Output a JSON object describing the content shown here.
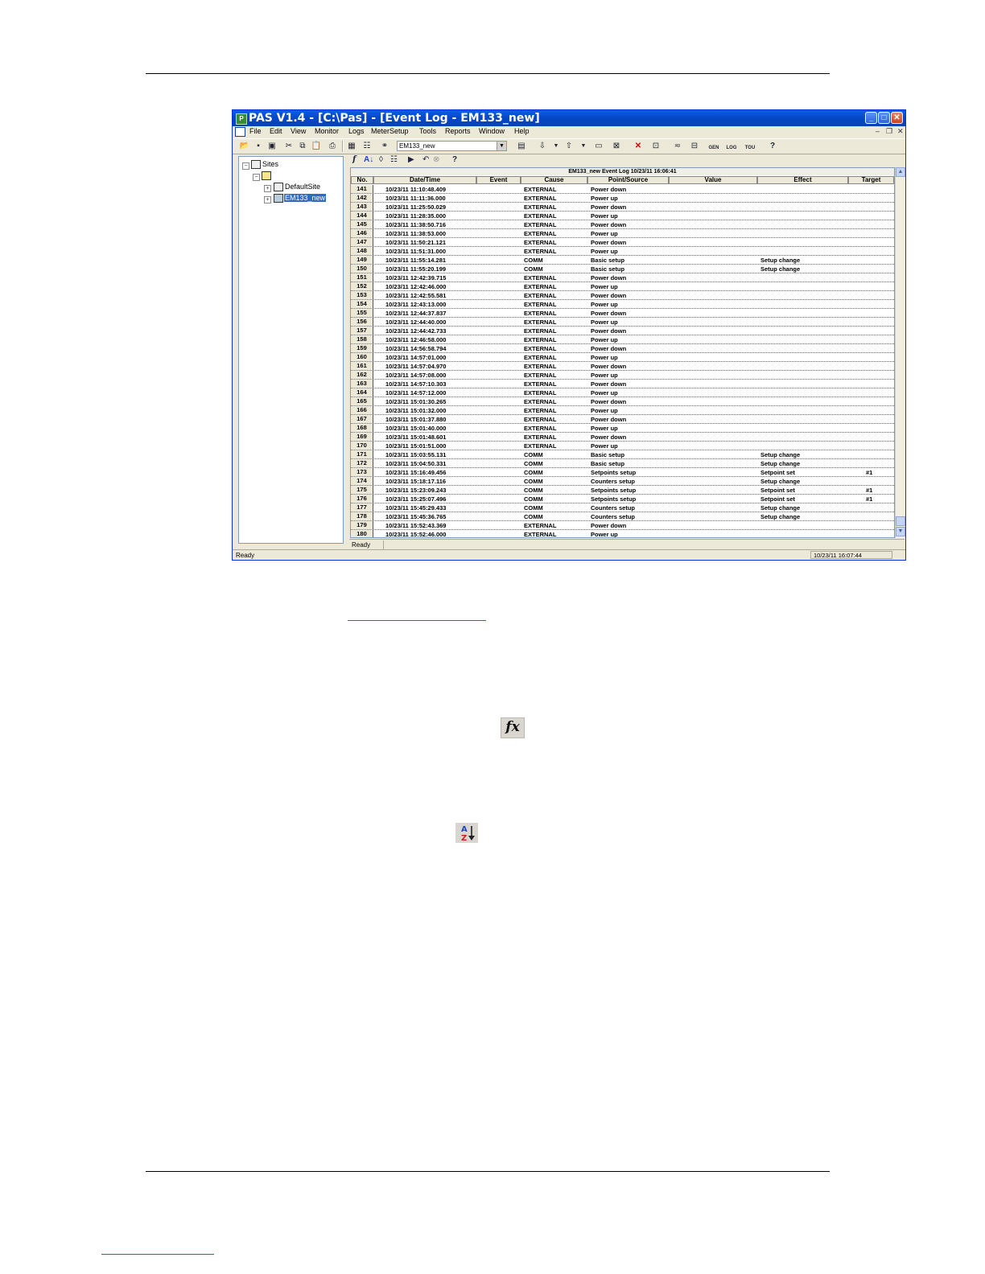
{
  "window": {
    "title": "PAS V1.4 - [C:\\Pas] - [Event Log - EM133_new]",
    "app_icon_label": "P"
  },
  "menu": [
    "File",
    "Edit",
    "View",
    "Monitor",
    "Logs",
    "MeterSetup",
    "Tools",
    "Reports",
    "Window",
    "Help"
  ],
  "toolbar": {
    "meter_selected": "EM133_new",
    "gen_label": "GEN",
    "log_label": "LOG",
    "tou_label": "TOU"
  },
  "tree": {
    "root": "Sites",
    "site": "DefaultSite",
    "meter": "EM133_new"
  },
  "grid": {
    "caption": "EM133_new  Event Log   10/23/11 16:06:41",
    "headers": [
      "No.",
      "Date/Time",
      "Event",
      "Cause",
      "Point/Source",
      "Value",
      "Effect",
      "Target"
    ],
    "rows": [
      [
        "141",
        "10/23/11  11:10:48.409",
        "",
        "EXTERNAL",
        "Power down",
        "",
        "",
        ""
      ],
      [
        "142",
        "10/23/11  11:11:36.000",
        "",
        "EXTERNAL",
        "Power up",
        "",
        "",
        ""
      ],
      [
        "143",
        "10/23/11  11:25:50.029",
        "",
        "EXTERNAL",
        "Power down",
        "",
        "",
        ""
      ],
      [
        "144",
        "10/23/11  11:28:35.000",
        "",
        "EXTERNAL",
        "Power up",
        "",
        "",
        ""
      ],
      [
        "145",
        "10/23/11  11:38:50.716",
        "",
        "EXTERNAL",
        "Power down",
        "",
        "",
        ""
      ],
      [
        "146",
        "10/23/11  11:38:53.000",
        "",
        "EXTERNAL",
        "Power up",
        "",
        "",
        ""
      ],
      [
        "147",
        "10/23/11  11:50:21.121",
        "",
        "EXTERNAL",
        "Power down",
        "",
        "",
        ""
      ],
      [
        "148",
        "10/23/11  11:51:31.000",
        "",
        "EXTERNAL",
        "Power up",
        "",
        "",
        ""
      ],
      [
        "149",
        "10/23/11  11:55:14.281",
        "",
        "COMM",
        "Basic setup",
        "",
        "Setup change",
        ""
      ],
      [
        "150",
        "10/23/11  11:55:20.199",
        "",
        "COMM",
        "Basic setup",
        "",
        "Setup change",
        ""
      ],
      [
        "151",
        "10/23/11  12:42:39.715",
        "",
        "EXTERNAL",
        "Power down",
        "",
        "",
        ""
      ],
      [
        "152",
        "10/23/11  12:42:46.000",
        "",
        "EXTERNAL",
        "Power up",
        "",
        "",
        ""
      ],
      [
        "153",
        "10/23/11  12:42:55.581",
        "",
        "EXTERNAL",
        "Power down",
        "",
        "",
        ""
      ],
      [
        "154",
        "10/23/11  12:43:13.000",
        "",
        "EXTERNAL",
        "Power up",
        "",
        "",
        ""
      ],
      [
        "155",
        "10/23/11  12:44:37.837",
        "",
        "EXTERNAL",
        "Power down",
        "",
        "",
        ""
      ],
      [
        "156",
        "10/23/11  12:44:40.000",
        "",
        "EXTERNAL",
        "Power up",
        "",
        "",
        ""
      ],
      [
        "157",
        "10/23/11  12:44:42.733",
        "",
        "EXTERNAL",
        "Power down",
        "",
        "",
        ""
      ],
      [
        "158",
        "10/23/11  12:46:58.000",
        "",
        "EXTERNAL",
        "Power up",
        "",
        "",
        ""
      ],
      [
        "159",
        "10/23/11  14:56:58.794",
        "",
        "EXTERNAL",
        "Power down",
        "",
        "",
        ""
      ],
      [
        "160",
        "10/23/11  14:57:01.000",
        "",
        "EXTERNAL",
        "Power up",
        "",
        "",
        ""
      ],
      [
        "161",
        "10/23/11  14:57:04.970",
        "",
        "EXTERNAL",
        "Power down",
        "",
        "",
        ""
      ],
      [
        "162",
        "10/23/11  14:57:08.000",
        "",
        "EXTERNAL",
        "Power up",
        "",
        "",
        ""
      ],
      [
        "163",
        "10/23/11  14:57:10.303",
        "",
        "EXTERNAL",
        "Power down",
        "",
        "",
        ""
      ],
      [
        "164",
        "10/23/11  14:57:12.000",
        "",
        "EXTERNAL",
        "Power up",
        "",
        "",
        ""
      ],
      [
        "165",
        "10/23/11  15:01:30.265",
        "",
        "EXTERNAL",
        "Power down",
        "",
        "",
        ""
      ],
      [
        "166",
        "10/23/11  15:01:32.000",
        "",
        "EXTERNAL",
        "Power up",
        "",
        "",
        ""
      ],
      [
        "167",
        "10/23/11  15:01:37.880",
        "",
        "EXTERNAL",
        "Power down",
        "",
        "",
        ""
      ],
      [
        "168",
        "10/23/11  15:01:40.000",
        "",
        "EXTERNAL",
        "Power up",
        "",
        "",
        ""
      ],
      [
        "169",
        "10/23/11  15:01:48.601",
        "",
        "EXTERNAL",
        "Power down",
        "",
        "",
        ""
      ],
      [
        "170",
        "10/23/11  15:01:51.000",
        "",
        "EXTERNAL",
        "Power up",
        "",
        "",
        ""
      ],
      [
        "171",
        "10/23/11  15:03:55.131",
        "",
        "COMM",
        "Basic setup",
        "",
        "Setup change",
        ""
      ],
      [
        "172",
        "10/23/11  15:04:50.331",
        "",
        "COMM",
        "Basic setup",
        "",
        "Setup change",
        ""
      ],
      [
        "173",
        "10/23/11  15:16:49.456",
        "",
        "COMM",
        "Setpoints setup",
        "",
        "Setpoint set",
        "#1"
      ],
      [
        "174",
        "10/23/11  15:18:17.116",
        "",
        "COMM",
        "Counters setup",
        "",
        "Setup change",
        ""
      ],
      [
        "175",
        "10/23/11  15:23:09.243",
        "",
        "COMM",
        "Setpoints setup",
        "",
        "Setpoint set",
        "#1"
      ],
      [
        "176",
        "10/23/11  15:25:07.496",
        "",
        "COMM",
        "Setpoints setup",
        "",
        "Setpoint set",
        "#1"
      ],
      [
        "177",
        "10/23/11  15:45:29.433",
        "",
        "COMM",
        "Counters setup",
        "",
        "Setup change",
        ""
      ],
      [
        "178",
        "10/23/11  15:45:36.765",
        "",
        "COMM",
        "Counters setup",
        "",
        "Setup change",
        ""
      ],
      [
        "179",
        "10/23/11  15:52:43.369",
        "",
        "EXTERNAL",
        "Power down",
        "",
        "",
        ""
      ],
      [
        "180",
        "10/23/11  15:52:46.000",
        "",
        "EXTERNAL",
        "Power up",
        "",
        "",
        ""
      ]
    ]
  },
  "status": {
    "inner": "Ready",
    "outer": "Ready",
    "clock": "10/23/11 16:07:44"
  },
  "document": {
    "fx_icon": "fx",
    "az_icon": "sort-az-icon"
  }
}
